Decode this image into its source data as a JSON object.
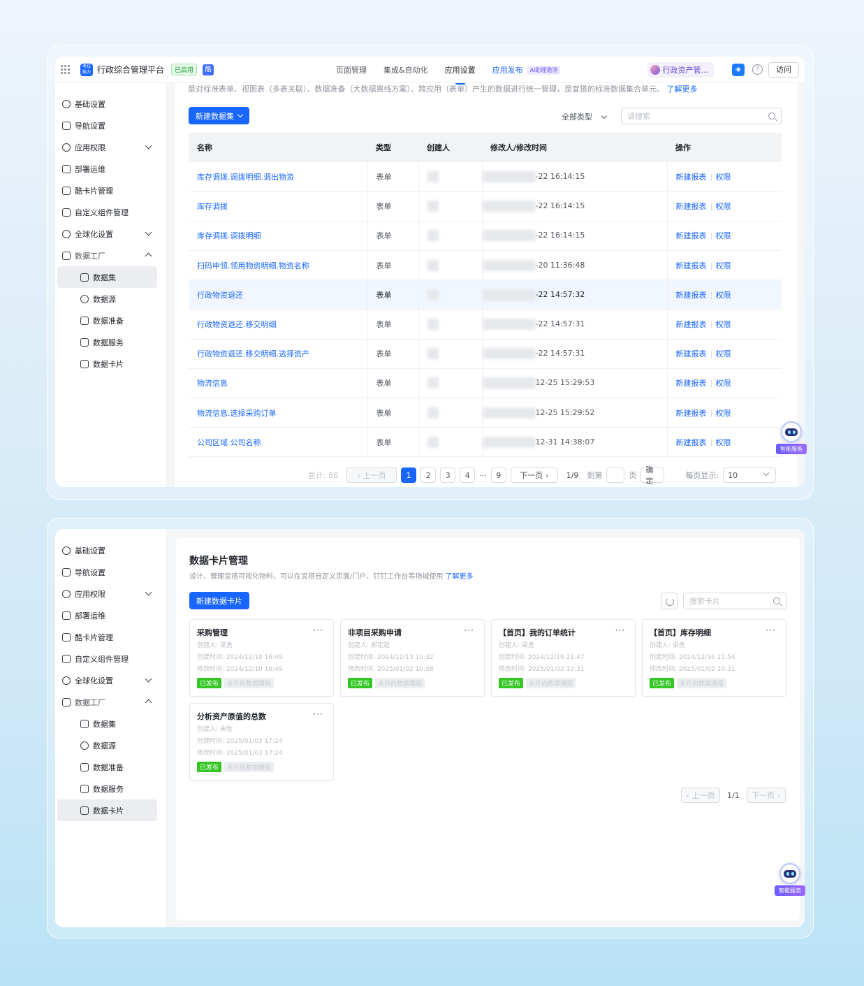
{
  "app": {
    "logo_text": "考拉\n脑力",
    "title": "行政综合管理平台",
    "status_badge": "已启用",
    "ding_badge": "酷",
    "nav": [
      "页面管理",
      "集成&自动化",
      "应用设置",
      "应用发布"
    ],
    "ai_tag": "AI助理邀测",
    "user_name": "行政资产管...",
    "help_icon": "?",
    "visit_button": "访问"
  },
  "sidebar": {
    "items": [
      {
        "label": "基础设置",
        "icon": "gear-icon"
      },
      {
        "label": "导航设置",
        "icon": "list-icon"
      },
      {
        "label": "应用权限",
        "icon": "user-icon",
        "expandable": true
      },
      {
        "label": "部署运维",
        "icon": "deploy-icon"
      },
      {
        "label": "酷卡片管理",
        "icon": "grid-icon"
      },
      {
        "label": "自定义组件管理",
        "icon": "puzzle-icon"
      },
      {
        "label": "全球化设置",
        "icon": "globe-icon",
        "expandable": true
      },
      {
        "label": "数据工厂",
        "icon": "factory-icon",
        "expanded": true
      }
    ],
    "sub_items": [
      {
        "label": "数据集",
        "icon": "dataset-icon"
      },
      {
        "label": "数据源",
        "icon": "database-icon"
      },
      {
        "label": "数据准备",
        "icon": "prepare-icon"
      },
      {
        "label": "数据服务",
        "icon": "service-icon"
      },
      {
        "label": "数据卡片",
        "icon": "card-icon"
      }
    ]
  },
  "dataset_page": {
    "description": "是对标准表单、视图表（多表关联）、数据准备（大数据离线方案）、跨应用（表单）产生的数据进行统一管理，是宜搭的标准数据集合单元。",
    "learn_more": "了解更多",
    "new_button": "新建数据集",
    "type_filter": "全部类型",
    "search_placeholder": "请搜索",
    "columns": [
      "名称",
      "类型",
      "创建人",
      "修改人/修改时间",
      "操作"
    ],
    "rows": [
      {
        "name": "库存调拨.调拨明细.调出物资",
        "type": "表单",
        "time": "-22 16:14:15"
      },
      {
        "name": "库存调拨",
        "type": "表单",
        "time": "-22 16:14:15"
      },
      {
        "name": "库存调拨.调拨明细",
        "type": "表单",
        "time": "-22 16:14:15"
      },
      {
        "name": "扫码申领.领用物资明细.物资名称",
        "type": "表单",
        "time": "-20 11:36:48"
      },
      {
        "name": "行政物资退还",
        "type": "表单",
        "time": "-22 14:57:32",
        "highlight": true
      },
      {
        "name": "行政物资退还.移交明细",
        "type": "表单",
        "time": "-22 14:57:31"
      },
      {
        "name": "行政物资退还.移交明细.选择资产",
        "type": "表单",
        "time": "-22 14:57:31"
      },
      {
        "name": "物流信息",
        "type": "表单",
        "time": "12-25 15:29:53"
      },
      {
        "name": "物流信息.选择采购订单",
        "type": "表单",
        "time": "12-25 15:29:52"
      },
      {
        "name": "公司区域.公司名称",
        "type": "表单",
        "time": "12-31 14:38:07"
      }
    ],
    "row_actions": [
      "新建报表",
      "权限"
    ],
    "pagination": {
      "total": "总计: 86",
      "prev": "上一页",
      "pages": [
        "1",
        "2",
        "3",
        "4",
        "···",
        "9"
      ],
      "current": "1",
      "next": "下一页",
      "page_info": "1/9",
      "goto_label": "到第",
      "page_unit": "页",
      "confirm": "确定",
      "per_page_label": "每页显示:",
      "per_page": "10"
    }
  },
  "robot": {
    "label": "智能服务"
  },
  "card_page": {
    "title": "数据卡片管理",
    "description": "设计、管理宜搭可视化物料，可以在宜搭自定义页面/门户、钉钉工作台等场域使用",
    "learn_more": "了解更多",
    "new_button": "新建数据卡片",
    "search_placeholder": "搜索卡片",
    "cards": [
      {
        "title": "采购管理",
        "creator": "创建人: 梁勇",
        "created": "创建时间: 2024/12/10 16:49",
        "modified": "修改时间: 2024/12/10 16:49",
        "tag_published": "已发布",
        "tag_report": "未开启数据播报"
      },
      {
        "title": "非项目采购申请",
        "creator": "创建人: 郑定超",
        "created": "创建时间: 2024/12/13 10:32",
        "modified": "修改时间: 2025/01/02 10:38",
        "tag_published": "已发布",
        "tag_report": "未开启数据播报"
      },
      {
        "title": "【首页】我的订单统计",
        "creator": "创建人: 梁勇",
        "created": "创建时间: 2024/12/16 21:47",
        "modified": "修改时间: 2025/01/02 10:31",
        "tag_published": "已发布",
        "tag_report": "未开启数据播报"
      },
      {
        "title": "【首页】库存明细",
        "creator": "创建人: 梁勇",
        "created": "创建时间: 2024/12/16 21:54",
        "modified": "修改时间: 2025/01/02 10:31",
        "tag_published": "已发布",
        "tag_report": "未开启数据播报"
      },
      {
        "title": "分析资产原值的总数",
        "creator": "创建人: 朱牧",
        "created": "创建时间: 2025/01/03 17:24",
        "modified": "修改时间: 2025/01/03 17:24",
        "tag_published": "已发布",
        "tag_report": "未开启数据播报"
      }
    ],
    "more_glyph": "···",
    "pagination": {
      "prev": "上一页",
      "info": "1/1",
      "next": "下一页"
    }
  }
}
